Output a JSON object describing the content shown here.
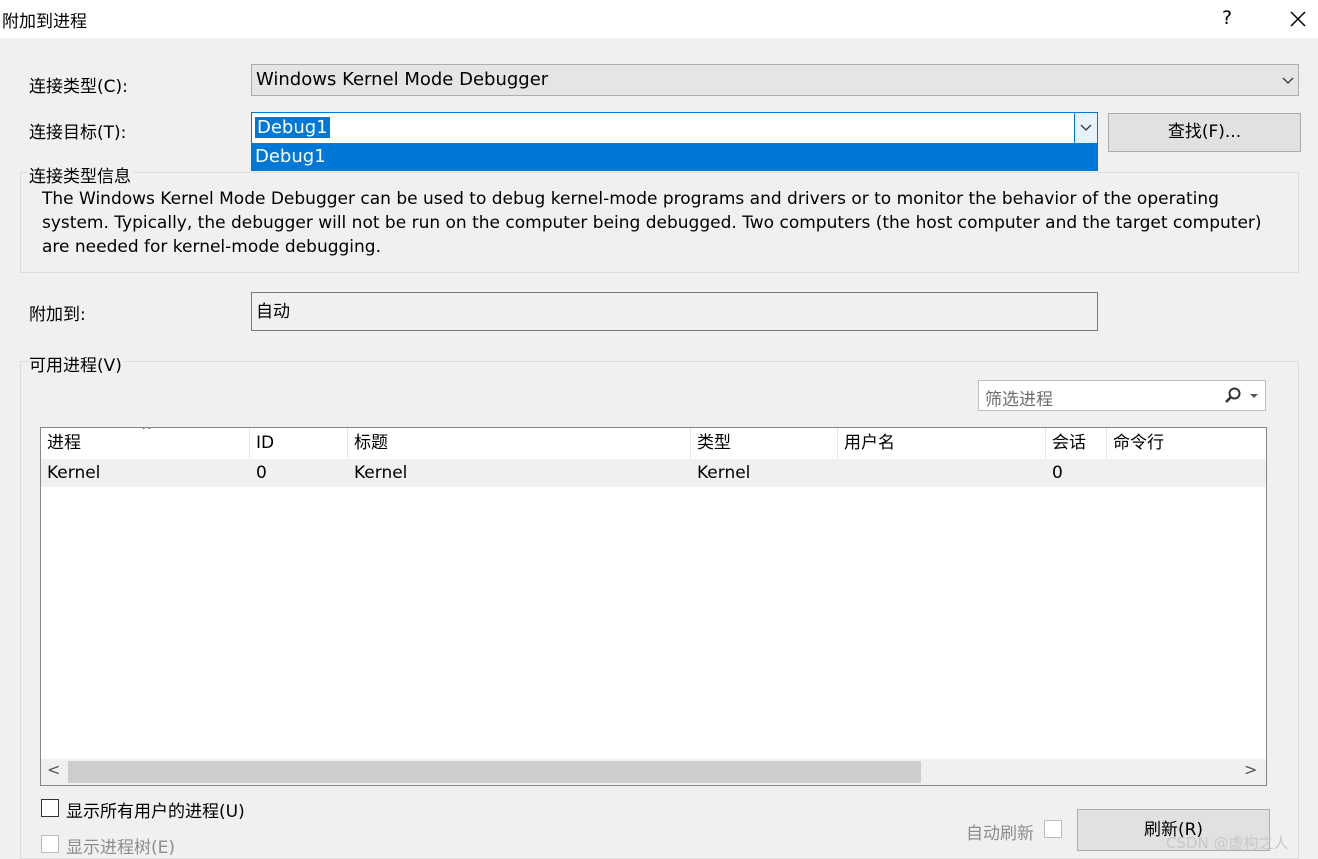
{
  "window": {
    "title": "附加到进程",
    "help_label": "?",
    "close_label": "✕"
  },
  "connection": {
    "type_label": "连接类型(C):",
    "type_value": "Windows Kernel Mode Debugger",
    "target_label": "连接目标(T):",
    "target_value": "Debug1",
    "dropdown_options": [
      "Debug1"
    ],
    "find_button": "查找(F)..."
  },
  "info": {
    "group_title": "连接类型信息",
    "text": "The Windows Kernel Mode Debugger can be used to debug kernel-mode programs and drivers or to monitor the behavior of the operating system. Typically, the debugger will not be run on the computer being debugged. Two computers (the host computer and the target computer) are needed for kernel-mode debugging."
  },
  "attach": {
    "label": "附加到:",
    "value": "自动"
  },
  "processes": {
    "group_title": "可用进程(V)",
    "filter_placeholder": "筛选进程",
    "columns": [
      "进程",
      "ID",
      "标题",
      "类型",
      "用户名",
      "会话",
      "命令行"
    ],
    "sort_indicator": "^",
    "rows": [
      {
        "process": "Kernel",
        "id": "0",
        "title": "Kernel",
        "type": "Kernel",
        "user": "",
        "session": "0",
        "cmdline": ""
      }
    ],
    "scroll_left": "<",
    "scroll_right": ">"
  },
  "options": {
    "show_all_users": "显示所有用户的进程(U)",
    "show_tree": "显示进程树(E)",
    "auto_refresh": "自动刷新",
    "refresh_button": "刷新(R)"
  },
  "watermark": "CSDN @虚构之人",
  "colors": {
    "accent": "#0078d7",
    "background": "#f0f0f0"
  }
}
